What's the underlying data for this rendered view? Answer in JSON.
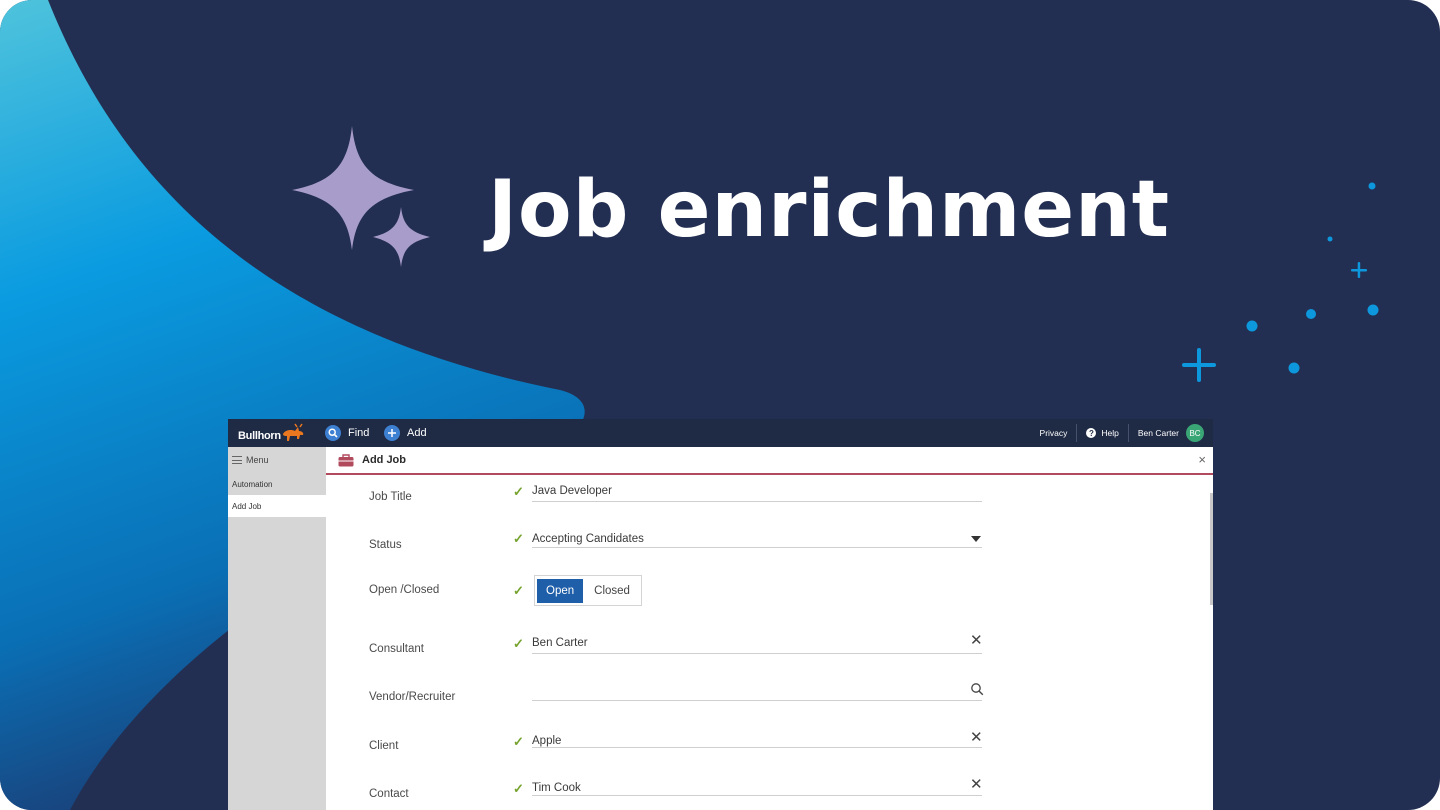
{
  "hero": {
    "title": "Job enrichment"
  },
  "colors": {
    "background": "#222f52",
    "accent_blue": "#0d97dc",
    "sparkle": "#a89ccb",
    "topbar": "#1f2a44",
    "panel_underline": "#b24a5e",
    "check": "#76a32e",
    "toggle_on": "#1f5ea8"
  },
  "app": {
    "logo": "Bullhorn",
    "nav": {
      "find": "Find",
      "add": "Add"
    },
    "topbar_right": {
      "privacy": "Privacy",
      "help": "Help",
      "user": "Ben Carter",
      "initials": "BC"
    },
    "sidebar": {
      "menu": "Menu",
      "items": [
        {
          "label": "Automation"
        },
        {
          "label": "Add Job"
        }
      ]
    },
    "panel": {
      "title": "Add Job",
      "close": "×",
      "fields": {
        "job_title": {
          "label": "Job Title",
          "value": "Java Developer"
        },
        "status": {
          "label": "Status",
          "value": "Accepting Candidates"
        },
        "open_closed": {
          "label": "Open /Closed",
          "options": [
            "Open",
            "Closed"
          ],
          "selected": "Open"
        },
        "consultant": {
          "label": "Consultant",
          "value": "Ben Carter"
        },
        "vendor": {
          "label": "Vendor/Recruiter",
          "value": ""
        },
        "client": {
          "label": "Client",
          "value": "Apple"
        },
        "contact": {
          "label": "Contact",
          "value": "Tim Cook"
        }
      }
    }
  }
}
